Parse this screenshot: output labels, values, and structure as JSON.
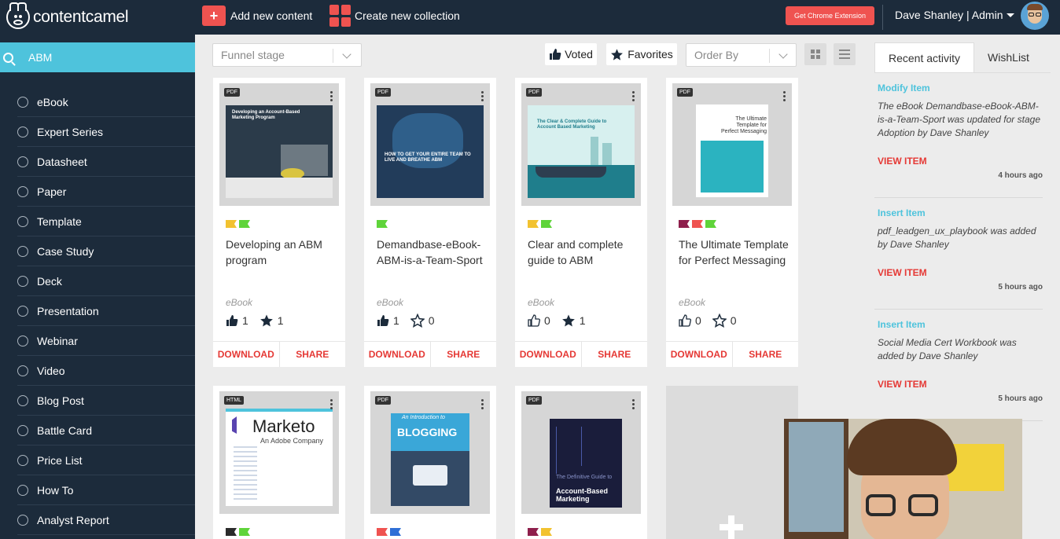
{
  "app": {
    "logo_text": "contentcamel"
  },
  "topbar": {
    "add_content_label": "Add new content",
    "create_collection_label": "Create new collection",
    "chrome_extension_label": "Get Chrome Extension",
    "user_label": "Dave Shanley | Admin"
  },
  "sidebar": {
    "search_value": "ABM",
    "items": [
      "eBook",
      "Expert Series",
      "Datasheet",
      "Paper",
      "Template",
      "Case Study",
      "Deck",
      "Presentation",
      "Webinar",
      "Video",
      "Blog Post",
      "Battle Card",
      "Price List",
      "How To",
      "Analyst Report"
    ]
  },
  "toolbar": {
    "funnel_stage_placeholder": "Funnel stage",
    "voted_label": "Voted",
    "favorites_label": "Favorites",
    "order_by_placeholder": "Order By"
  },
  "cards": [
    {
      "type": "PDF",
      "title": "Developing an ABM program",
      "category": "eBook",
      "votes": "1",
      "favorites": "1",
      "voted": true,
      "favorited": true,
      "cover_text": "Developing an Account-Based Marketing Program",
      "flag_colors": [
        "#f2c230",
        "#5fd43a"
      ]
    },
    {
      "type": "PDF",
      "title": "Demandbase-eBook-ABM-is-a-Team-Sport",
      "category": "eBook",
      "votes": "1",
      "favorites": "0",
      "voted": true,
      "favorited": false,
      "cover_text": "HOW TO GET YOUR ENTIRE TEAM TO LIVE AND BREATHE ABM",
      "flag_colors": [
        "#5fd43a"
      ]
    },
    {
      "type": "PDF",
      "title": "Clear and complete guide to ABM",
      "category": "eBook",
      "votes": "0",
      "favorites": "1",
      "voted": false,
      "favorited": true,
      "cover_text": "The Clear & Complete Guide to Account Based Marketing",
      "flag_colors": [
        "#f2c230",
        "#5fd43a"
      ]
    },
    {
      "type": "PDF",
      "title": "The Ultimate Template for Perfect Messaging",
      "category": "eBook",
      "votes": "0",
      "favorites": "0",
      "voted": false,
      "favorited": false,
      "cover_text": "The Ultimate Template for Perfect Messaging",
      "flag_colors": [
        "#8e1f4c",
        "#ef5350",
        "#5fd43a"
      ]
    },
    {
      "type": "HTML",
      "cover_text": "Marketo",
      "cover_subtext": "An Adobe Company",
      "flag_colors": [
        "#2b2b2b",
        "#5fd43a"
      ]
    },
    {
      "type": "PDF",
      "cover_text": "BLOGGING",
      "cover_subtext": "An Introduction to",
      "flag_colors": [
        "#ef5350",
        "#2f6fd6"
      ]
    },
    {
      "type": "PDF",
      "cover_text": "Account-Based Marketing",
      "cover_subtext": "The Definitive Guide to",
      "flag_colors": [
        "#8e1f4c",
        "#f2c230"
      ]
    }
  ],
  "card_actions": {
    "download": "DOWNLOAD",
    "share": "SHARE"
  },
  "panel": {
    "tab_recent": "Recent activity",
    "tab_wishlist": "WishList",
    "activities": [
      {
        "type": "Modify Item",
        "desc": "The eBook Demandbase-eBook-ABM-is-a-Team-Sport was updated for stage Adoption by Dave Shanley",
        "view": "VIEW ITEM",
        "time": "4 hours ago"
      },
      {
        "type": "Insert Item",
        "desc": "pdf_leadgen_ux_playbook was added by Dave Shanley",
        "view": "VIEW ITEM",
        "time": "5 hours ago"
      },
      {
        "type": "Insert Item",
        "desc": "Social Media Cert Workbook was added by Dave Shanley",
        "view": "VIEW ITEM",
        "time": "5 hours ago"
      }
    ]
  },
  "colors": {
    "navy": "#1c2b3b",
    "accent_red": "#ef5350",
    "accent_cyan": "#4ec3dc"
  }
}
